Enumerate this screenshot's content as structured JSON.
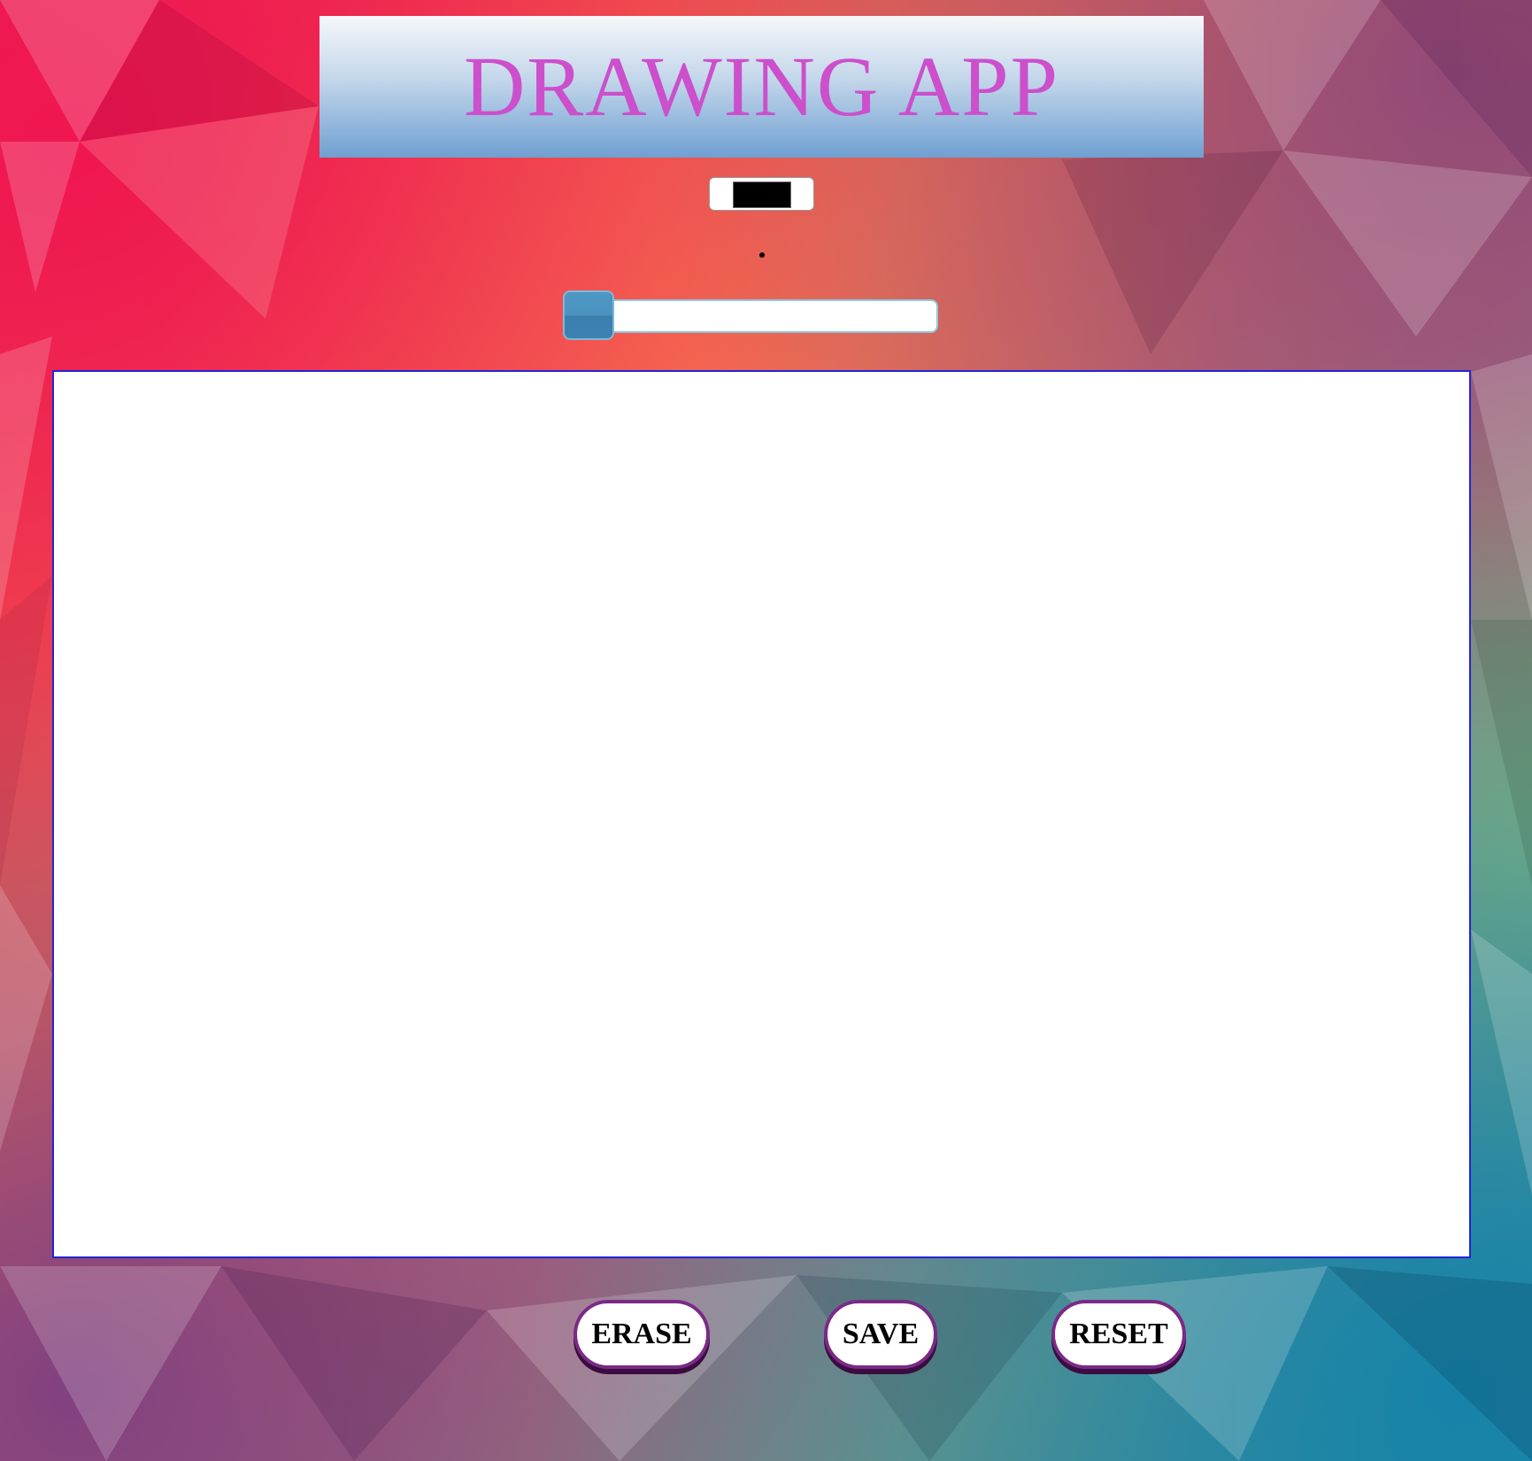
{
  "app": {
    "title": "DRAWING APP"
  },
  "toolbar": {
    "color_picker": {
      "value": "#000000"
    },
    "brush_size": {
      "value_fraction": 0
    }
  },
  "actions": {
    "erase_label": "ERASE",
    "save_label": "SAVE",
    "reset_label": "RESET"
  },
  "colors": {
    "title": "#cc4fcc",
    "canvas_border": "#2323d8",
    "button_border": "#7a2a86",
    "slider_thumb": "#4a92c0"
  }
}
